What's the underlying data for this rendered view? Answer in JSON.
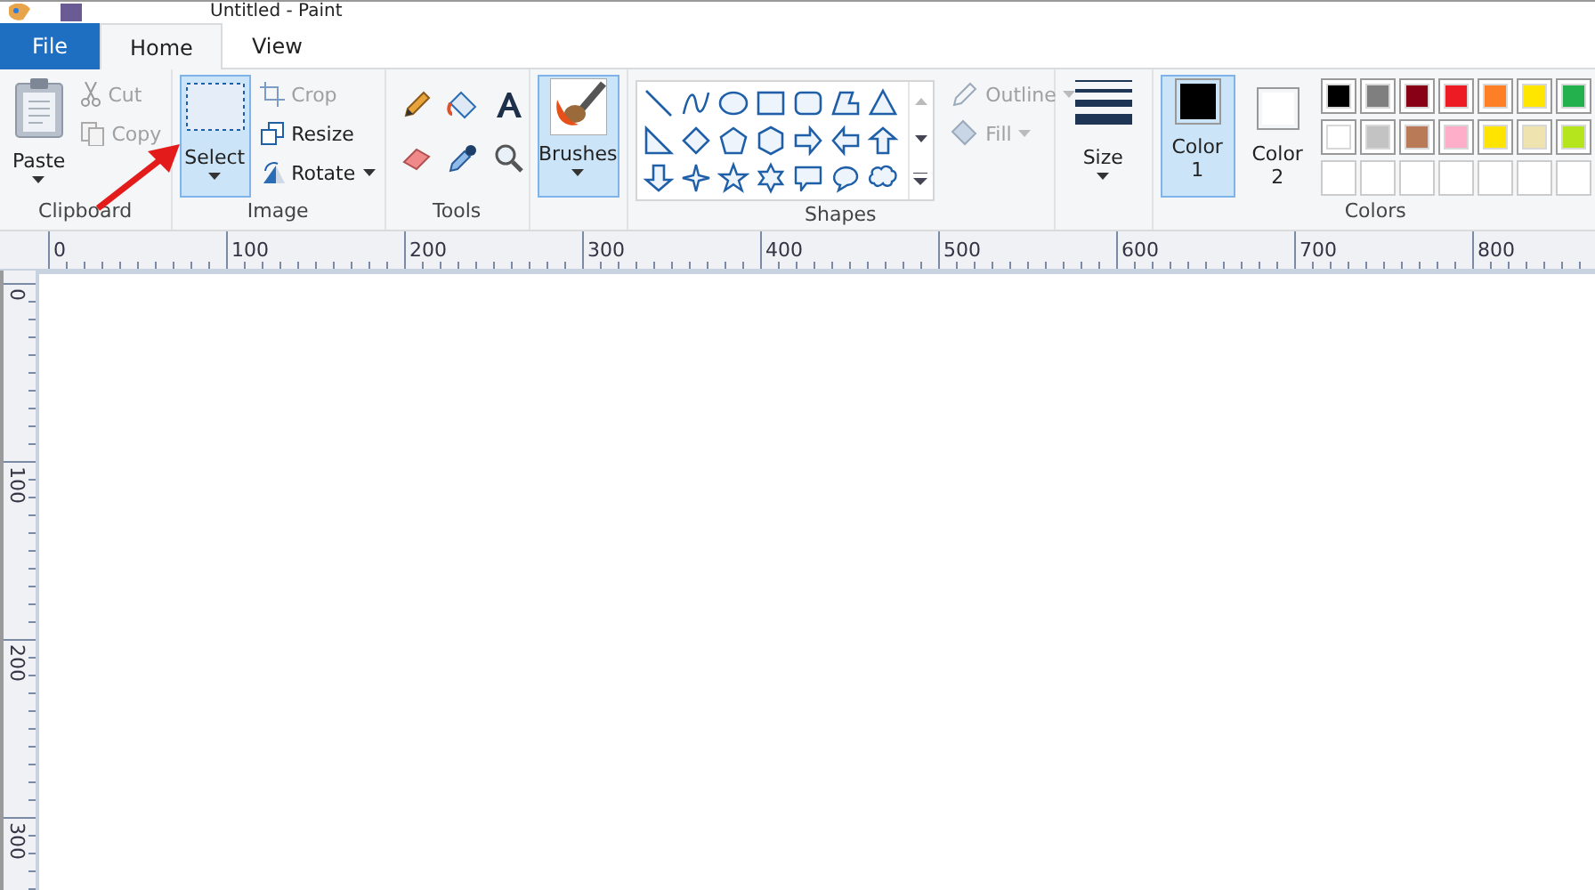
{
  "window": {
    "title": "Untitled - Paint"
  },
  "tabs": [
    {
      "label": "File",
      "kind": "file",
      "selected": false
    },
    {
      "label": "Home",
      "kind": "tab",
      "selected": true
    },
    {
      "label": "View",
      "kind": "tab",
      "selected": false
    }
  ],
  "clipboard": {
    "label": "Clipboard",
    "paste": "Paste",
    "cut": {
      "label": "Cut",
      "disabled": true
    },
    "copy": {
      "label": "Copy",
      "disabled": true
    }
  },
  "image": {
    "label": "Image",
    "select": {
      "label": "Select",
      "selected": true
    },
    "crop": {
      "label": "Crop",
      "disabled": true
    },
    "resize": {
      "label": "Resize",
      "disabled": false
    },
    "rotate": {
      "label": "Rotate",
      "disabled": false
    }
  },
  "tools": {
    "label": "Tools"
  },
  "brushes": {
    "label": "Brushes",
    "selected": true
  },
  "shapes": {
    "label": "Shapes",
    "outline": {
      "label": "Outline",
      "disabled": true
    },
    "fill": {
      "label": "Fill",
      "disabled": true
    }
  },
  "size": {
    "label": "Size"
  },
  "colors": {
    "label": "Colors",
    "color1": {
      "label": "Color",
      "number": "1",
      "selected": true,
      "color": "#000000"
    },
    "color2": {
      "label": "Color",
      "number": "2",
      "selected": false,
      "color": "#ffffff"
    },
    "palette": [
      {
        "kind": "swatch",
        "color": "#000000"
      },
      {
        "kind": "swatch",
        "color": "#7f7f7f"
      },
      {
        "kind": "swatch",
        "color": "#880015"
      },
      {
        "kind": "swatch",
        "color": "#ed1c24"
      },
      {
        "kind": "swatch",
        "color": "#ff7f27"
      },
      {
        "kind": "swatch",
        "color": "#ffe600"
      },
      {
        "kind": "swatch",
        "color": "#22b14c"
      },
      {
        "kind": "swatch",
        "color": "#ffffff"
      },
      {
        "kind": "swatch",
        "color": "#c3c3c3"
      },
      {
        "kind": "swatch",
        "color": "#b97a57"
      },
      {
        "kind": "swatch",
        "color": "#ffaec9"
      },
      {
        "kind": "swatch",
        "color": "#ffe400"
      },
      {
        "kind": "swatch",
        "color": "#efe4b0"
      },
      {
        "kind": "swatch",
        "color": "#b5e61d"
      },
      {
        "kind": "empty"
      },
      {
        "kind": "empty"
      },
      {
        "kind": "empty"
      },
      {
        "kind": "empty"
      },
      {
        "kind": "empty"
      },
      {
        "kind": "empty"
      },
      {
        "kind": "empty"
      }
    ]
  },
  "ruler_horizontal": [
    "0",
    "100",
    "200",
    "300",
    "400",
    "500",
    "600",
    "700",
    "800"
  ],
  "ruler_vertical": [
    "0",
    "100",
    "200",
    "300"
  ]
}
